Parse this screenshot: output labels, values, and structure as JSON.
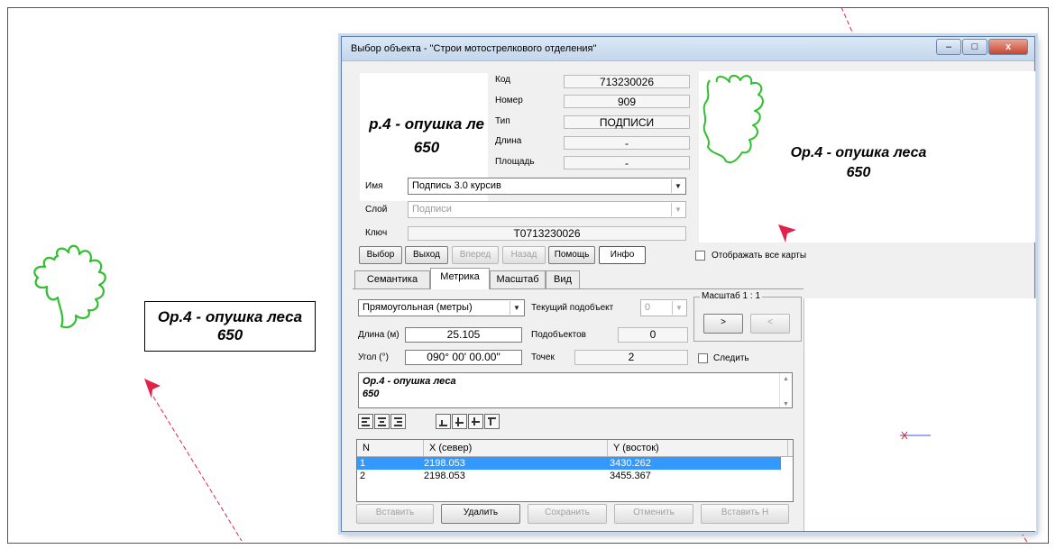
{
  "map": {
    "label_line1": "Ор.4 - опушка леса",
    "label_line2": "650"
  },
  "window": {
    "title": "Выбор объекта - \"Строи мотострелкового отделения\"",
    "controls": {
      "minimize": "–",
      "maximize": "□",
      "close": "x"
    }
  },
  "preview": {
    "text_line1": "р.4 - опушка ле",
    "text_line2": "650"
  },
  "info": {
    "code_label": "Код",
    "code_value": "713230026",
    "number_label": "Номер",
    "number_value": "909",
    "type_label": "Тип",
    "type_value": "ПОДПИСИ",
    "length_label": "Длина",
    "length_value": "-",
    "area_label": "Площадь",
    "area_value": "-"
  },
  "right_preview": {
    "text_line1": "Ор.4 - опушка леса",
    "text_line2": "650"
  },
  "fields": {
    "name_label": "Имя",
    "name_value": "Подпись 3.0 курсив",
    "layer_label": "Слой",
    "layer_value": "Подписи",
    "key_label": "Ключ",
    "key_value": "Т0713230026"
  },
  "buttons": {
    "select": "Выбор",
    "exit": "Выход",
    "forward": "Вперед",
    "back": "Назад",
    "help": "Помощь",
    "info": "Инфо"
  },
  "show_all_maps": {
    "label": "Отображать все карты",
    "checked": false
  },
  "tabs": [
    {
      "label": "Семантика",
      "active": false
    },
    {
      "label": "Метрика",
      "active": true
    },
    {
      "label": "Масштаб",
      "active": false
    },
    {
      "label": "Вид",
      "active": false
    }
  ],
  "metrics": {
    "projection_value": "Прямоугольная (метры)",
    "current_sub_label": "Текущий подобъект",
    "current_sub_value": "0",
    "length_label": "Длина (м)",
    "length_value": "25.105",
    "subobjects_label": "Подобъектов",
    "subobjects_value": "0",
    "angle_label": "Угол (°)",
    "angle_value": "090° 00' 00.00\"",
    "points_label": "Точек",
    "points_value": "2",
    "scale_caption": "Масштаб 1 : 1",
    "scale_next": ">",
    "scale_prev": "<",
    "follow_label": "Следить",
    "text_line1": "Ор.4 - опушка леса",
    "text_line2": "650"
  },
  "table": {
    "headers": [
      "N",
      "X  (север)",
      "Y  (восток)"
    ],
    "rows": [
      {
        "n": "1",
        "x": "2198.053",
        "y": "3430.262",
        "selected": true
      },
      {
        "n": "2",
        "x": "2198.053",
        "y": "3455.367",
        "selected": false
      }
    ]
  },
  "bottom_buttons": {
    "insert": "Вставить",
    "delete": "Удалить",
    "save": "Сохранить",
    "cancel": "Отменить",
    "insert_n": "Вставить Н"
  },
  "colors": {
    "contour": "#2fbf2f",
    "arrow": "#e0224a",
    "selection": "#3399ff"
  }
}
